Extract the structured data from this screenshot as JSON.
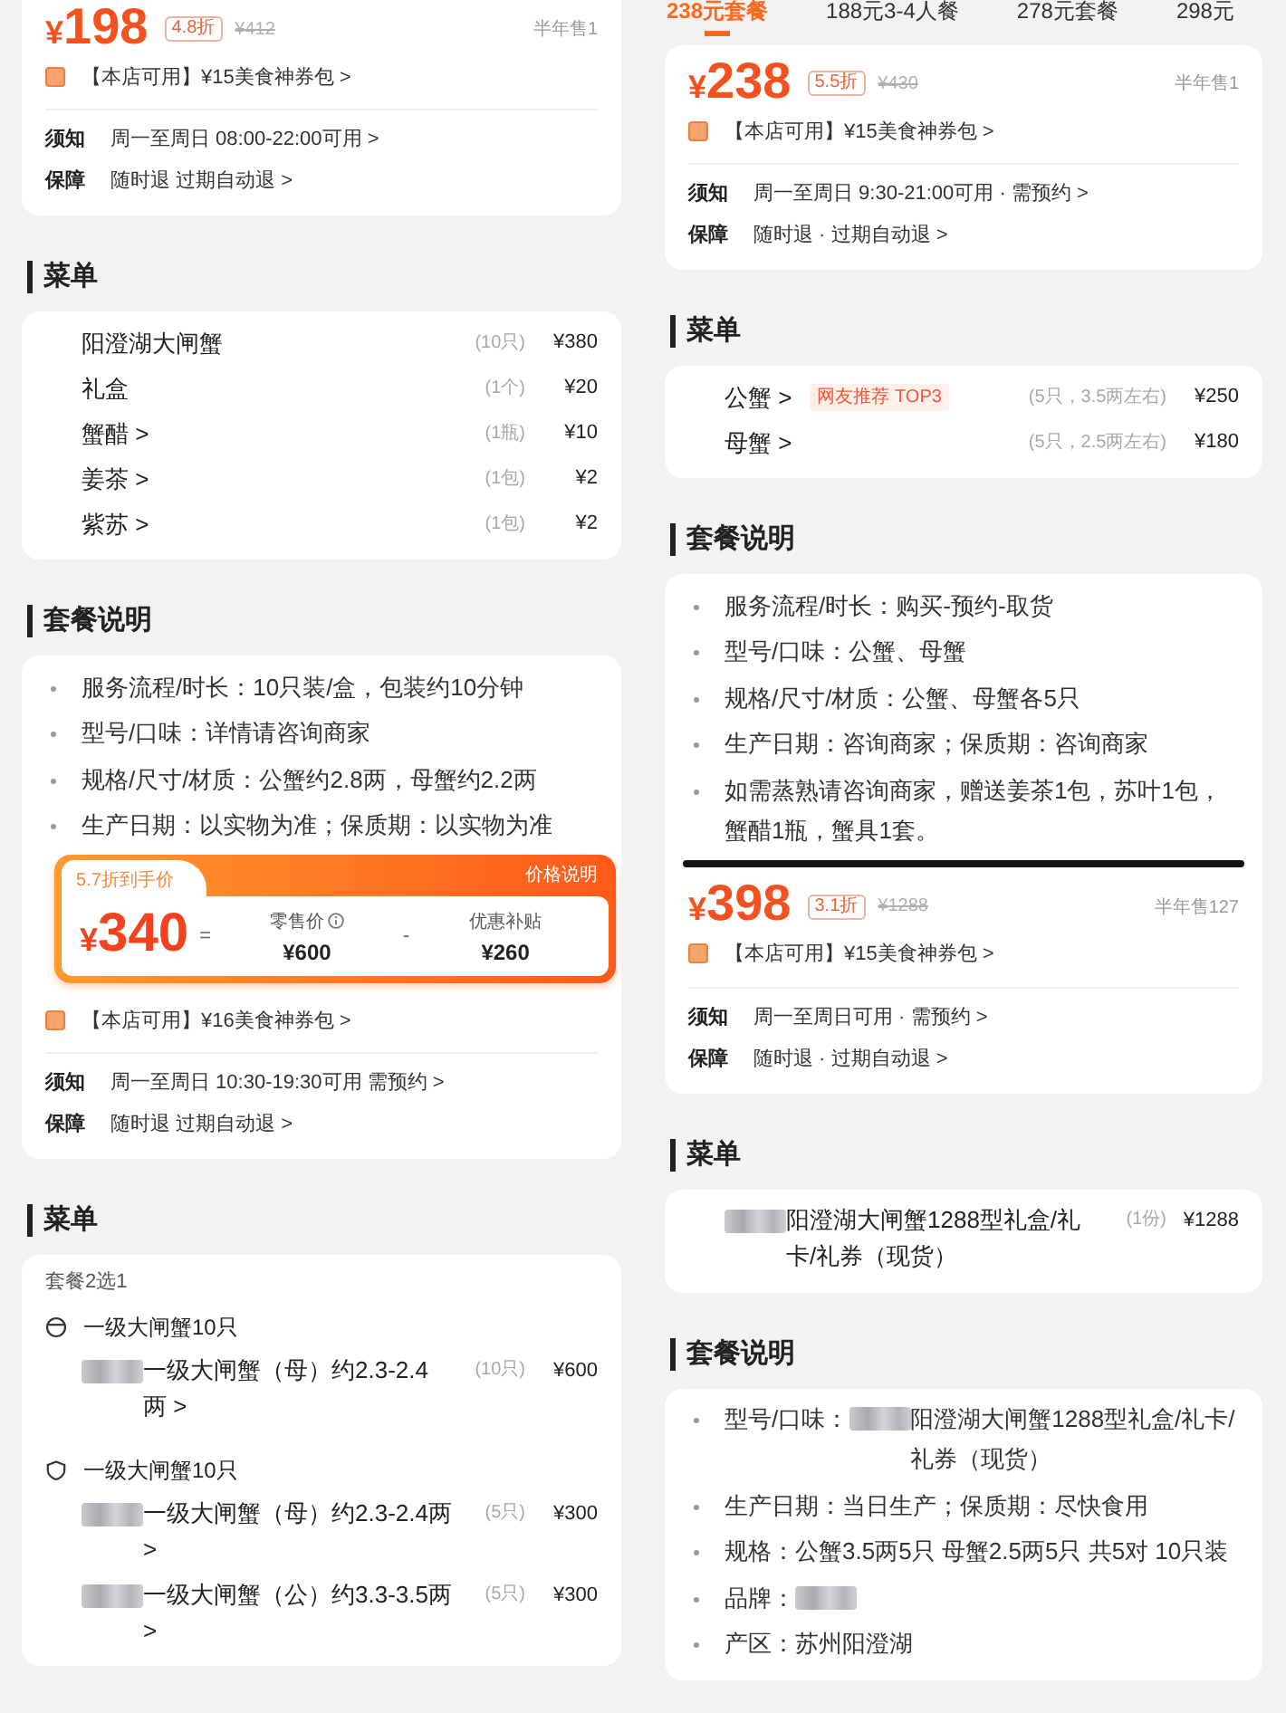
{
  "columns": [
    {
      "blocks": [
        {
          "kind": "card",
          "parts": [
            {
              "kind": "price",
              "price": "¥198",
              "discount": "4.8折",
              "original_price": "¥412",
              "sales": "半年售1"
            },
            {
              "kind": "coupon",
              "text": "【本店可用】¥15美食神券包 >"
            },
            {
              "kind": "divider"
            },
            {
              "kind": "notice",
              "label": "须知",
              "text": "周一至周日 08:00-22:00可用 >"
            },
            {
              "kind": "notice",
              "label": "保障",
              "text": "随时退  过期自动退 >"
            }
          ]
        },
        {
          "kind": "heading",
          "title": "菜单"
        },
        {
          "kind": "card",
          "parts": [
            {
              "kind": "menu_item",
              "redacted": false,
              "name": "阳澄湖大闸蟹",
              "quantity": "(10只)",
              "price": "¥380"
            },
            {
              "kind": "menu_item",
              "redacted": false,
              "name": "礼盒",
              "quantity": "(1个)",
              "price": "¥20"
            },
            {
              "kind": "menu_item",
              "redacted": false,
              "name": "蟹醋 >",
              "quantity": "(1瓶)",
              "price": "¥10"
            },
            {
              "kind": "menu_item",
              "redacted": false,
              "name": "姜茶 >",
              "quantity": "(1包)",
              "price": "¥2"
            },
            {
              "kind": "menu_item",
              "redacted": false,
              "name": "紫苏 >",
              "quantity": "(1包)",
              "price": "¥2"
            }
          ]
        },
        {
          "kind": "heading",
          "title": "套餐说明"
        },
        {
          "kind": "card",
          "parts": [
            {
              "kind": "bullet",
              "redacted": false,
              "text": "服务流程/时长：10只装/盒，包装约10分钟"
            },
            {
              "kind": "bullet",
              "redacted": false,
              "text": "型号/口味：详情请咨询商家"
            },
            {
              "kind": "bullet",
              "redacted": false,
              "text": "规格/尺寸/材质：公蟹约2.8两，母蟹约2.2两"
            },
            {
              "kind": "bullet",
              "redacted": false,
              "text": "生产日期：以实物为准；保质期：以实物为准"
            },
            {
              "kind": "price_panel",
              "label": "5.7折到手价",
              "corner": "价格说明",
              "price": "¥340",
              "stats": [
                {
                  "operator": "=",
                  "label": "零售价",
                  "info": true,
                  "value": "¥600"
                },
                {
                  "operator": "-",
                  "label": "优惠补贴",
                  "info": false,
                  "value": "¥260"
                }
              ]
            },
            {
              "kind": "coupon",
              "text": "【本店可用】¥16美食神券包 >"
            },
            {
              "kind": "divider"
            },
            {
              "kind": "notice",
              "label": "须知",
              "text": "周一至周日 10:30-19:30可用  需预约 >"
            },
            {
              "kind": "notice",
              "label": "保障",
              "text": "随时退  过期自动退 >"
            }
          ]
        },
        {
          "kind": "heading",
          "title": "菜单"
        },
        {
          "kind": "card",
          "parts": [
            {
              "kind": "note",
              "text": "套餐2选1"
            },
            {
              "kind": "option",
              "marker": {
                "kind": "circle"
              },
              "title": "一级大闸蟹10只"
            },
            {
              "kind": "menu_item",
              "redacted": true,
              "name": "一级大闸蟹（母）约2.3-2.4两 >",
              "quantity": "(10只)",
              "price": "¥600"
            },
            {
              "kind": "option",
              "marker": {
                "kind": "shield"
              },
              "title": "一级大闸蟹10只"
            },
            {
              "kind": "menu_item",
              "redacted": true,
              "name": "一级大闸蟹（母）约2.3-2.4两 >",
              "quantity": "(5只)",
              "price": "¥300"
            },
            {
              "kind": "menu_item",
              "redacted": true,
              "name": "一级大闸蟹（公）约3.3-3.5两 >",
              "quantity": "(5只)",
              "price": "¥300"
            }
          ]
        }
      ]
    },
    {
      "tabs": [
        {
          "label": "238元套餐",
          "selected": true
        },
        {
          "label": "188元3-4人餐",
          "selected": false
        },
        {
          "label": "278元套餐",
          "selected": false
        },
        {
          "label": "298元",
          "selected": false
        }
      ],
      "blocks": [
        {
          "kind": "card",
          "parts": [
            {
              "kind": "price",
              "price": "¥238",
              "discount": "5.5折",
              "original_price": "¥430",
              "sales": "半年售1"
            },
            {
              "kind": "coupon",
              "text": "【本店可用】¥15美食神券包 >"
            },
            {
              "kind": "divider"
            },
            {
              "kind": "notice",
              "label": "须知",
              "text": "周一至周日 9:30-21:00可用 · 需预约 >"
            },
            {
              "kind": "notice",
              "label": "保障",
              "text": "随时退 · 过期自动退 >"
            }
          ]
        },
        {
          "kind": "heading",
          "title": "菜单"
        },
        {
          "kind": "card",
          "parts": [
            {
              "kind": "menu_item",
              "redacted": false,
              "name": "公蟹 >",
              "tag": "网友推荐 TOP3",
              "quantity": "(5只，3.5两左右)",
              "price": "¥250"
            },
            {
              "kind": "menu_item",
              "redacted": false,
              "name": "母蟹 >",
              "quantity": "(5只，2.5两左右)",
              "price": "¥180"
            }
          ]
        },
        {
          "kind": "heading",
          "title": "套餐说明"
        },
        {
          "kind": "card",
          "parts": [
            {
              "kind": "bullet",
              "redacted": false,
              "text": "服务流程/时长：购买-预约-取货"
            },
            {
              "kind": "bullet",
              "redacted": false,
              "text": "型号/口味：公蟹、母蟹"
            },
            {
              "kind": "bullet",
              "redacted": false,
              "text": "规格/尺寸/材质：公蟹、母蟹各5只"
            },
            {
              "kind": "bullet",
              "redacted": false,
              "text": "生产日期：咨询商家；保质期：咨询商家"
            },
            {
              "kind": "bullet",
              "redacted": false,
              "text": "如需蒸熟请咨询商家，赠送姜茶1包，苏叶1包，蟹醋1瓶，蟹具1套。"
            },
            {
              "kind": "edge"
            },
            {
              "kind": "price",
              "price": "¥398",
              "discount": "3.1折",
              "original_price": "¥1288",
              "sales": "半年售127"
            },
            {
              "kind": "coupon",
              "text": "【本店可用】¥15美食神券包 >"
            },
            {
              "kind": "divider"
            },
            {
              "kind": "notice",
              "label": "须知",
              "text": "周一至周日可用 · 需预约 >"
            },
            {
              "kind": "notice",
              "label": "保障",
              "text": "随时退 · 过期自动退 >"
            }
          ]
        },
        {
          "kind": "heading",
          "title": "菜单"
        },
        {
          "kind": "card",
          "parts": [
            {
              "kind": "menu_item",
              "redacted": true,
              "name": "阳澄湖大闸蟹1288型礼盒/礼卡/礼券（现货）",
              "quantity": "(1份)",
              "price": "¥1288"
            }
          ]
        },
        {
          "kind": "heading",
          "title": "套餐说明"
        },
        {
          "kind": "card",
          "parts": [
            {
              "kind": "bullet",
              "lead": "型号/口味：",
              "redacted": true,
              "text": "阳澄湖大闸蟹1288型礼盒/礼卡/礼券（现货）"
            },
            {
              "kind": "bullet",
              "redacted": false,
              "text": "生产日期：当日生产；保质期：尽快食用"
            },
            {
              "kind": "bullet",
              "redacted": false,
              "text": "规格：公蟹3.5两5只 母蟹2.5两5只 共5对 10只装"
            },
            {
              "kind": "bullet",
              "lead": "品牌：",
              "redacted": true
            },
            {
              "kind": "bullet",
              "redacted": false,
              "text": "产区：苏州阳澄湖"
            }
          ]
        }
      ]
    }
  ]
}
